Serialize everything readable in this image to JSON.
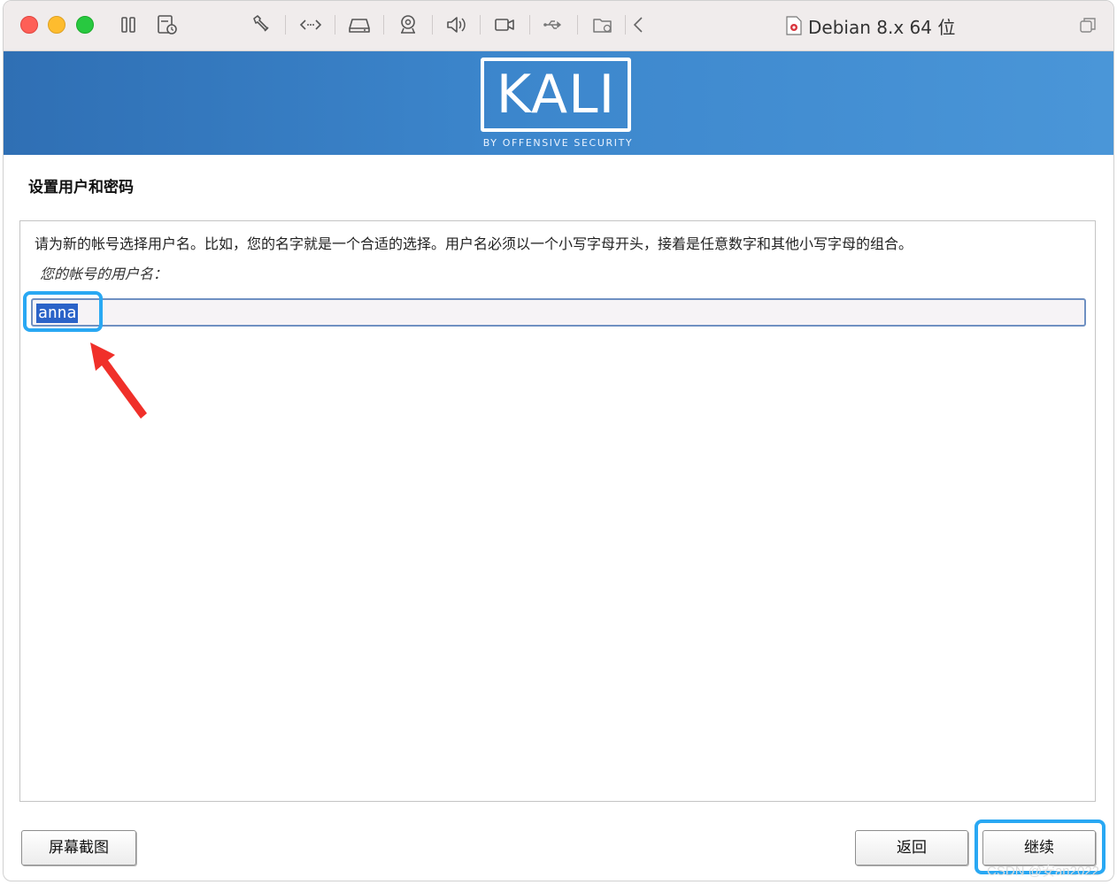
{
  "window": {
    "title": "Debian 8.x 64 位"
  },
  "banner": {
    "logo_text": "KALI",
    "logo_subtitle": "BY OFFENSIVE SECURITY"
  },
  "page": {
    "title": "设置用户和密码",
    "instruction": "请为新的帐号选择用户名。比如，您的名字就是一个合适的选择。用户名必须以一个小写字母开头，接着是任意数字和其他小写字母的组合。",
    "field_label": "您的帐号的用户名：",
    "username_value": "anna"
  },
  "buttons": {
    "screenshot": "屏幕截图",
    "back": "返回",
    "continue": "继续"
  },
  "watermark": "CSDN @安an2022",
  "colors": {
    "highlight": "#29a8f3",
    "arrow": "#f0302a",
    "banner": "#3c86cc",
    "selection": "#2b63c8"
  },
  "icons": [
    "pause-icon",
    "snapshot-icon",
    "wrench-icon",
    "code-arrows-icon",
    "drive-icon",
    "camera-icon",
    "speaker-icon",
    "video-camera-icon",
    "usb-icon",
    "shared-folder-icon",
    "back-chevron-icon",
    "document-icon",
    "restore-window-icon"
  ]
}
